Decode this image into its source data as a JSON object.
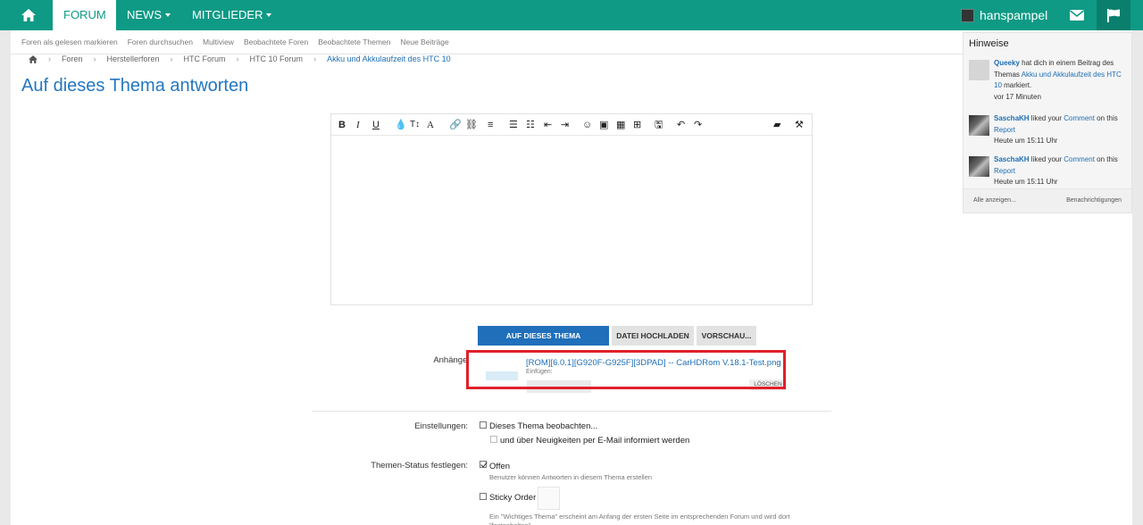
{
  "topbar": {
    "tabs": [
      {
        "label": "FORUM"
      },
      {
        "label": "NEWS"
      },
      {
        "label": "MITGLIEDER"
      }
    ],
    "username": "hanspampel"
  },
  "subnav": [
    "Foren als gelesen markieren",
    "Foren durchsuchen",
    "Multiview",
    "Beobachtete Foren",
    "Beobachtete Themen",
    "Neue Beiträge"
  ],
  "breadcrumb": [
    "Foren",
    "Herstellerforen",
    "HTC Forum",
    "HTC 10 Forum",
    "Akku und Akkulaufzeit des HTC 10"
  ],
  "page_title": "Auf dieses Thema antworten",
  "buttons": {
    "reply": "AUF DIESES THEMA ANTWORTEN",
    "upload": "DATEI HOCHLADEN",
    "preview": "VORSCHAU..."
  },
  "attachments": {
    "label": "Anhänge:",
    "filename": "[ROM][6.0.1][G920F-G925F][3DPAD] -- CarHDRom V.18.1-Test.png",
    "insert_label": "Einfügen:",
    "thumb_glyph": " ",
    "delete_label": "LÖSCHEN"
  },
  "settings": {
    "label": "Einstellungen:",
    "watch": "Dieses Thema beobachten...",
    "email": "und über Neuigkeiten per E-Mail informiert werden"
  },
  "status": {
    "label": "Themen-Status festlegen:",
    "open": "Offen",
    "open_hint": "Benutzer können Antworten in diesem Thema erstellen",
    "sticky": "Sticky Order",
    "sticky_hint": "Ein \"Wichtiges Thema\" erscheint am Anfang der ersten Seite im entsprechenden Forum und wird dort \"festgehalten\"."
  },
  "notifications": {
    "title": "Hinweise",
    "items": [
      {
        "user": "Queeky",
        "pre": " hat dich in einem Beitrag des Themas ",
        "link": "Akku und Akkulaufzeit des HTC 10",
        "post": " markiert.",
        "time": "vor 17 Minuten"
      },
      {
        "user": "SaschaKH",
        "pre": " liked your ",
        "link": "Comment",
        "post": " on this ",
        "link2": "Report",
        "time": "Heute um 15:11 Uhr"
      },
      {
        "user": "SaschaKH",
        "pre": " liked your ",
        "link": "Comment",
        "post": " on this ",
        "link2": "Report",
        "time": "Heute um 15:11 Uhr"
      }
    ],
    "show_all": "Alle anzeigen...",
    "settings_link": "Benachrichtigungen"
  },
  "colors": {
    "brand": "#0e9a85",
    "link": "#1e6fb5",
    "primary_button": "#1f6fba",
    "highlight": "#e0202a"
  }
}
